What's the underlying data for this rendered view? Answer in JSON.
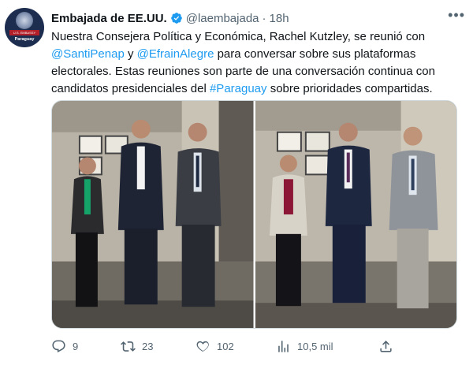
{
  "account": {
    "name": "Embajada de EE.UU.",
    "handle": "@laembajada",
    "separator": "·",
    "time": "18h",
    "avatar_band": "U.S. EMBASSY",
    "avatar_label": "Paraguay",
    "verified_color": "#1d9bf0"
  },
  "tweet": {
    "part1": "Nuestra Consejera Política y Económica, Rachel Kutzley, se reunió con ",
    "mention1": "@SantiPenap",
    "part2": " y ",
    "mention2": "@EfrainAlegre",
    "part3": " para conversar sobre sus plataformas electorales. Estas reuniones son parte de una conversación continua con candidatos presidenciales del ",
    "hashtag": "#Paraguay",
    "part4": " sobre prioridades compartidas."
  },
  "actions": {
    "replies": "9",
    "retweets": "23",
    "likes": "102",
    "views": "10,5 mil"
  },
  "icons": {
    "more": "more-icon",
    "reply": "reply-icon",
    "retweet": "retweet-icon",
    "like": "heart-icon",
    "views": "views-icon",
    "share": "share-icon"
  },
  "colors": {
    "link": "#1d9bf0",
    "secondary_text": "#536471"
  }
}
